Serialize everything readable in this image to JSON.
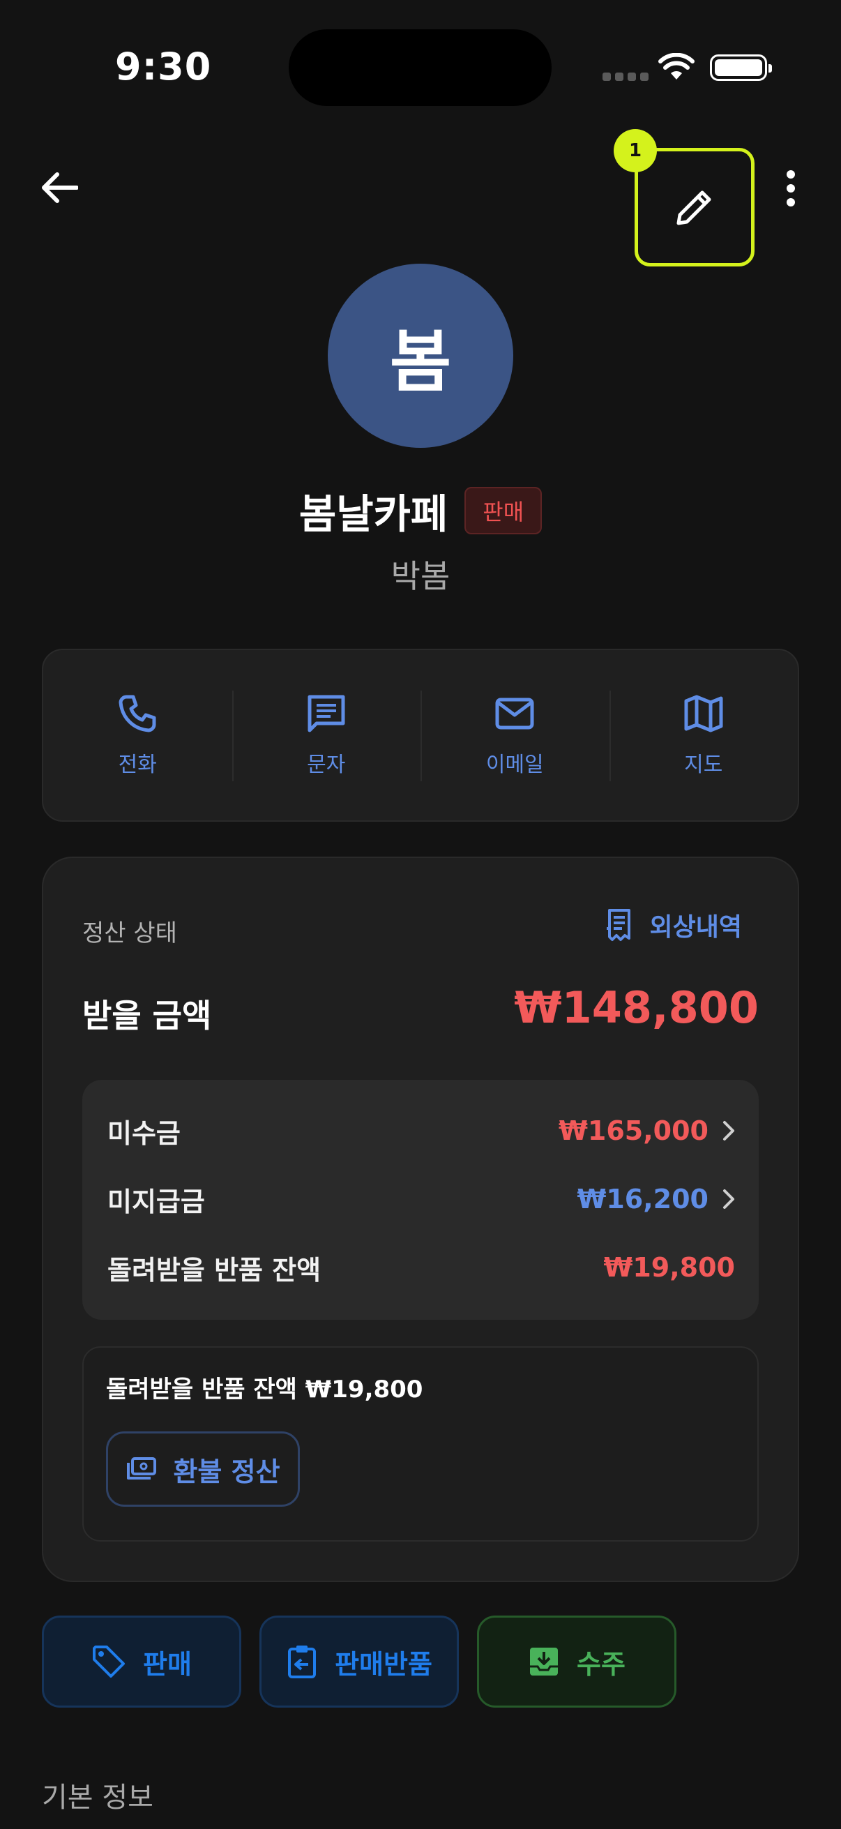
{
  "status_bar": {
    "time": "9:30"
  },
  "nav": {
    "edit_badge": "1"
  },
  "profile": {
    "avatar_text": "봄",
    "name": "봄날카페",
    "type_badge": "판매",
    "contact_name": "박봄"
  },
  "actions": [
    {
      "label": "전화",
      "icon": "phone-icon"
    },
    {
      "label": "문자",
      "icon": "message-icon"
    },
    {
      "label": "이메일",
      "icon": "email-icon"
    },
    {
      "label": "지도",
      "icon": "map-icon"
    }
  ],
  "settlement": {
    "header": "정산 상태",
    "ledger_link": "외상내역",
    "receive_label": "받을 금액",
    "receive_amount": "₩148,800",
    "rows": [
      {
        "label": "미수금",
        "value": "₩165,000",
        "color": "#f25a5a"
      },
      {
        "label": "미지급금",
        "value": "₩16,200",
        "color": "#5f8de6"
      },
      {
        "label": "돌려받을 반품 잔액",
        "value": "₩19,800",
        "color": "#f25a5a"
      }
    ],
    "refund_text": "돌려받을 반품 잔액 ₩19,800",
    "refund_button": "환불 정산"
  },
  "documents": [
    {
      "label": "판매",
      "icon": "tag-icon"
    },
    {
      "label": "판매반품",
      "icon": "clipboard-return-icon"
    },
    {
      "label": "수주",
      "icon": "inbox-download-icon"
    }
  ],
  "section_title": "기본 정보",
  "colors": {
    "accent_blue": "#5f8de6",
    "alert_red": "#f25a5a",
    "highlight": "#d4f21c",
    "order_green": "#49b25a"
  }
}
